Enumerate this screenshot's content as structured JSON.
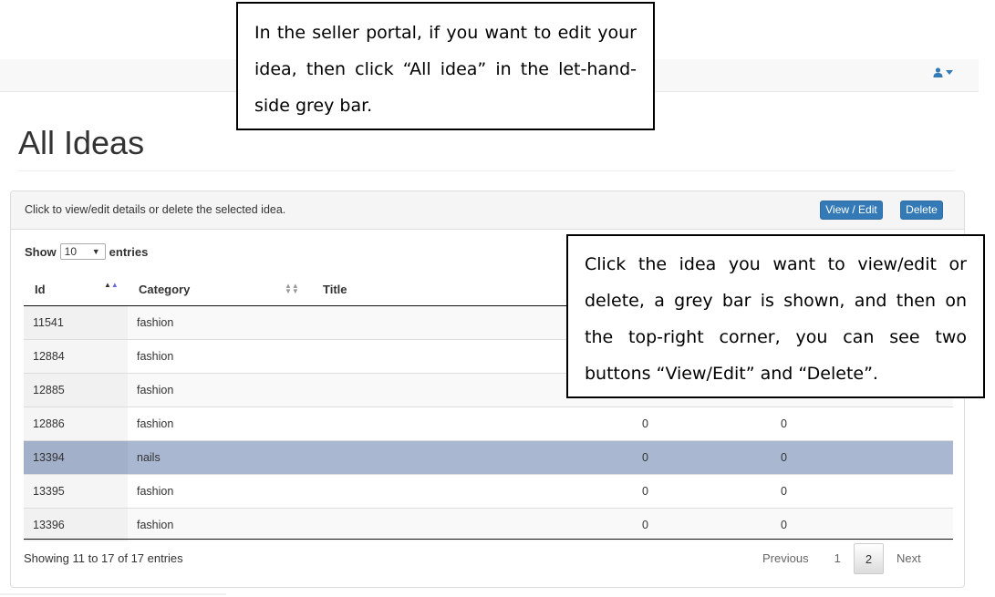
{
  "header": {
    "user_icon": "user-icon",
    "dropdown_icon": "caret-down-icon"
  },
  "page": {
    "title": "All Ideas"
  },
  "panel": {
    "hint": "Click to view/edit details or delete the selected idea.",
    "view_edit_label": "View / Edit",
    "delete_label": "Delete"
  },
  "length": {
    "show_label": "Show",
    "entries_label": "entries",
    "selected": "10"
  },
  "table": {
    "columns": [
      "Id",
      "Category",
      "Title"
    ],
    "rows": [
      {
        "id": "11541",
        "category": "fashion",
        "v1": "",
        "v2": ""
      },
      {
        "id": "12884",
        "category": "fashion",
        "v1": "",
        "v2": ""
      },
      {
        "id": "12885",
        "category": "fashion",
        "v1": "",
        "v2": ""
      },
      {
        "id": "12886",
        "category": "fashion",
        "v1": "0",
        "v2": "0"
      },
      {
        "id": "13394",
        "category": "nails",
        "v1": "0",
        "v2": "0"
      },
      {
        "id": "13395",
        "category": "fashion",
        "v1": "0",
        "v2": "0"
      },
      {
        "id": "13396",
        "category": "fashion",
        "v1": "0",
        "v2": "0"
      }
    ],
    "selected_row": 4
  },
  "footer": {
    "info": "Showing 11 to 17 of 17 entries",
    "previous": "Previous",
    "pages": [
      "1",
      "2"
    ],
    "current_page": "2",
    "next": "Next"
  },
  "callouts": {
    "top": "In the seller portal, if you want to edit your idea, then click “All idea” in the let-hand-side grey bar.",
    "right": "Click the idea you want to view/edit or delete, a grey bar is shown, and then on the top-right corner, you can see two buttons “View/Edit” and “Delete”."
  },
  "colors": {
    "primary": "#337ab7",
    "selected_row": "#a9b7d1"
  }
}
